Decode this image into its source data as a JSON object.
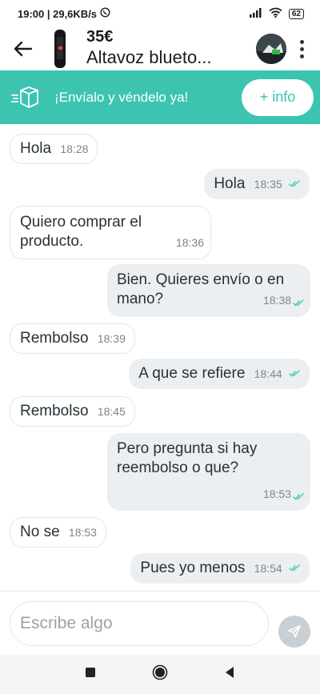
{
  "status_bar": {
    "time_speed": "19:00 | 29,6KB/s",
    "battery": "62"
  },
  "header": {
    "price": "35€",
    "title": "Altavoz blueto..."
  },
  "banner": {
    "text": "¡Envíalo y véndelo ya!",
    "info_button": "+ info"
  },
  "messages": [
    {
      "dir": "in",
      "text": "Hola",
      "time": "18:28"
    },
    {
      "dir": "out",
      "text": "Hola",
      "time": "18:35"
    },
    {
      "dir": "in",
      "text": "Quiero comprar el producto.",
      "time": "18:36"
    },
    {
      "dir": "out",
      "text": "Bien. Quieres envío o en mano?",
      "time": "18:38"
    },
    {
      "dir": "in",
      "text": "Rembolso",
      "time": "18:39"
    },
    {
      "dir": "out",
      "text": "A que se refiere",
      "time": "18:44"
    },
    {
      "dir": "in",
      "text": "Rembolso",
      "time": "18:45"
    },
    {
      "dir": "out",
      "text": "Pero pregunta si hay reembolso o que?",
      "time": "18:53"
    },
    {
      "dir": "in",
      "text": "No se",
      "time": "18:53"
    },
    {
      "dir": "out",
      "text": "Pues yo menos",
      "time": "18:54"
    }
  ],
  "input": {
    "placeholder": "Escribe algo"
  },
  "colors": {
    "accent": "#3cc4b1",
    "outgoing_bubble": "#eceff1",
    "read_ticks": "#3cc4b1"
  },
  "icons": [
    "whatsapp-icon",
    "signal-icon",
    "wifi-icon",
    "back-arrow-icon",
    "package-icon",
    "send-icon",
    "nav-square-icon",
    "nav-circle-icon",
    "nav-triangle-icon"
  ]
}
